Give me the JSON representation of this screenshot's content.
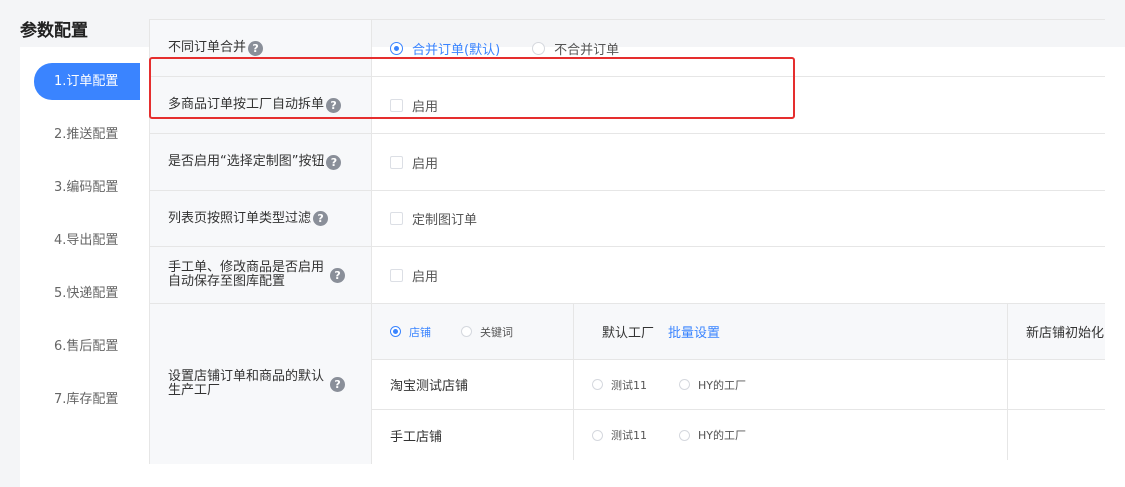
{
  "page": {
    "title": "参数配置"
  },
  "nav": {
    "items": [
      "1.订单配置",
      "2.推送配置",
      "3.编码配置",
      "4.导出配置",
      "5.快递配置",
      "6.售后配置",
      "7.库存配置"
    ]
  },
  "rows": {
    "merge": {
      "label": "不同订单合并",
      "opt1": "合并订单(默认)",
      "opt2": "不合并订单"
    },
    "split": {
      "label": "多商品订单按工厂自动拆单",
      "opt": "启用"
    },
    "custom_btn": {
      "label": "是否启用“选择定制图”按钮",
      "opt": "启用"
    },
    "filter": {
      "label": "列表页按照订单类型过滤",
      "opt": "定制图订单"
    },
    "autosave": {
      "label_line1": "手工单、修改商品是否启用",
      "label_line2": "自动保存至图库配置",
      "opt": "启用"
    },
    "factory": {
      "label_line1": "设置店铺订单和商品的默认",
      "label_line2": "生产工厂",
      "mode_store": "店铺",
      "mode_keyword": "关键词",
      "default_factory": "默认工厂",
      "batch": "批量设置",
      "new_store_init": "新店铺初始化",
      "stores": [
        {
          "name": "淘宝测试店铺",
          "f1": "测试11",
          "f2": "HY的工厂"
        },
        {
          "name": "手工店铺",
          "f1": "测试11",
          "f2": "HY的工厂"
        }
      ]
    }
  },
  "help_icon": "?",
  "colors": {
    "accent": "#3a84ff",
    "highlight": "#e52e2e"
  }
}
